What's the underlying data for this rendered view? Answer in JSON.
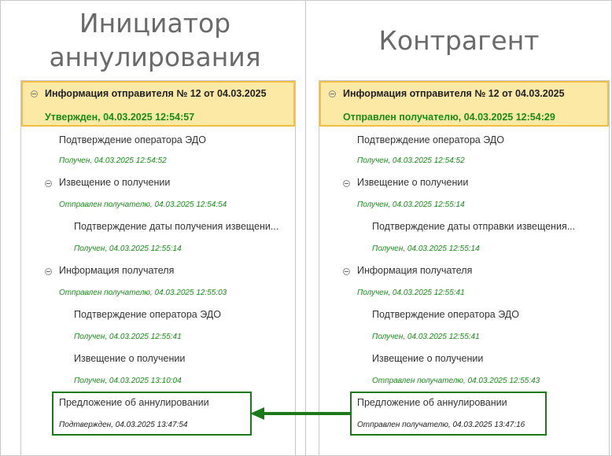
{
  "left": {
    "heading_line1": "Инициатор",
    "heading_line2": "аннулирования",
    "root": {
      "title": "Информация отправителя № 12 от 04.03.2025",
      "status": "Утвержден, 04.03.2025 12:54:57"
    },
    "nodes": [
      {
        "title": "Подтверждение оператора ЭДО",
        "status": "Получен, 04.03.2025 12:54:52"
      },
      {
        "title": "Извещение о получении",
        "status": "Отправлен получателю, 04.03.2025 12:54:54"
      },
      {
        "title": "Подтверждение даты получения извещени...",
        "status": "Получен, 04.03.2025 12:55:14"
      },
      {
        "title": "Информация получателя",
        "status": "Отправлен получателю, 04.03.2025 12:55:03"
      },
      {
        "title": "Подтверждение оператора ЭДО",
        "status": "Получен, 04.03.2025 12:55:41"
      },
      {
        "title": "Извещение о получении",
        "status": "Получен, 04.03.2025 13:10:04"
      },
      {
        "title": "Предложение об аннулировании",
        "status": "Подтвержден, 04.03.2025 13:47:54"
      }
    ]
  },
  "right": {
    "heading": "Контрагент",
    "root": {
      "title": "Информация отправителя № 12 от 04.03.2025",
      "status": "Отправлен получателю, 04.03.2025 12:54:29"
    },
    "nodes": [
      {
        "title": "Подтверждение оператора ЭДО",
        "status": "Получен, 04.03.2025 12:54:52"
      },
      {
        "title": "Извещение о получении",
        "status": "Получен, 04.03.2025 12:55:14"
      },
      {
        "title": "Подтверждение даты отправки извещения...",
        "status": "Получен, 04.03.2025 12:55:14"
      },
      {
        "title": "Информация получателя",
        "status": "Получен, 04.03.2025 12:55:41"
      },
      {
        "title": "Подтверждение оператора ЭДО",
        "status": "Получен, 04.03.2025 12:55:41"
      },
      {
        "title": "Извещение о получении",
        "status": "Отправлен получателю, 04.03.2025 12:55:43"
      },
      {
        "title": "Предложение об аннулировании",
        "status": "Отправлен получателю, 04.03.2025 13:47:16"
      }
    ]
  },
  "colors": {
    "root_fill": "#fde9a6",
    "root_border": "#f0c044",
    "status_green": "#1a8a1a",
    "highlight_green": "#1a7a1a"
  },
  "icons": [
    "collapse-icon",
    "arrow-left-icon"
  ]
}
